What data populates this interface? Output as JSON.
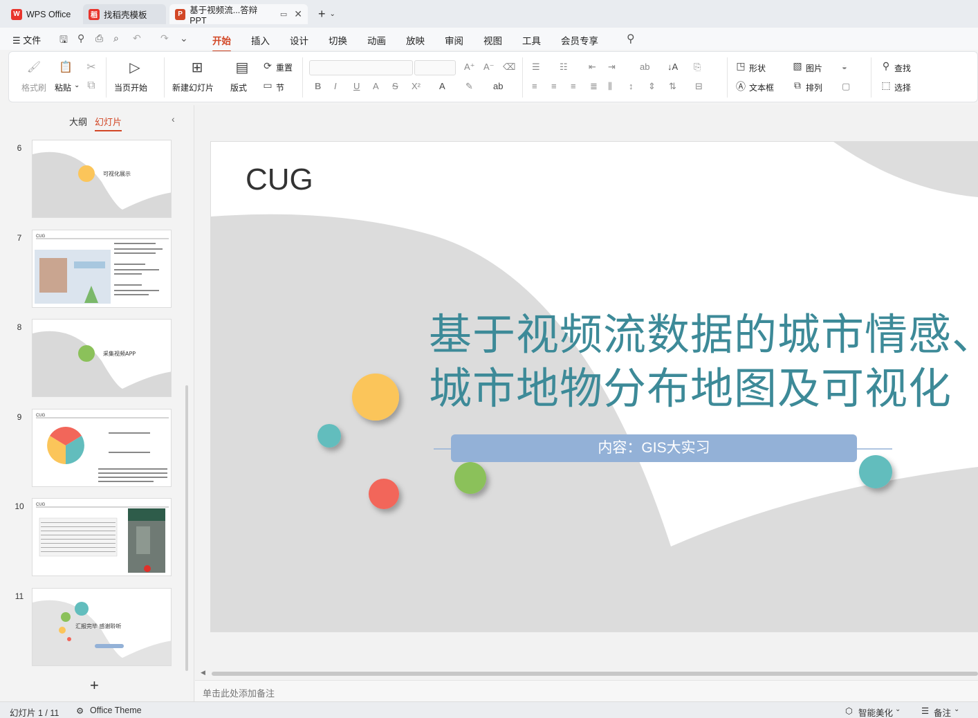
{
  "tabs": {
    "wps": "WPS Office",
    "daoke": "找稻壳模板",
    "doc": "基于视频流...答辩PPT"
  },
  "menu": {
    "file": "文件",
    "tabs": [
      "开始",
      "插入",
      "设计",
      "切换",
      "动画",
      "放映",
      "审阅",
      "视图",
      "工具",
      "会员专享"
    ],
    "active": "开始"
  },
  "ribbon": {
    "format_painter": "格式刷",
    "paste": "粘贴",
    "play_from_current": "当页开始",
    "new_slide": "新建幻灯片",
    "layout": "版式",
    "reset": "重置",
    "section": "节",
    "shape": "形状",
    "picture": "图片",
    "find": "查找",
    "textbox": "文本框",
    "arrange": "排列",
    "select": "选择"
  },
  "left_panel": {
    "outline_tab": "大纲",
    "slides_tab": "幻灯片",
    "slide_numbers": [
      "6",
      "7",
      "8",
      "9",
      "10",
      "11"
    ],
    "thumb6_text": "可视化展示",
    "thumb8_text": "采集视频APP",
    "thumb11_text": "汇报完毕 感谢聆听"
  },
  "slide": {
    "logo_text": "CUG",
    "title_line1": "基于视频流数据的城市情感、",
    "title_line2": "城市地物分布地图及可视化",
    "subtitle": "内容：GIS大实习"
  },
  "notes_placeholder": "单击此处添加备注",
  "status": {
    "slide_counter": "幻灯片 1 / 11",
    "theme": "Office Theme",
    "beautify": "智能美化",
    "notes": "备注"
  },
  "colors": {
    "accent": "#d24726",
    "title": "#3d8a98",
    "subtitle_bar": "#93b1d7",
    "dot_yellow": "#fbc55a",
    "dot_teal": "#62bdbd",
    "dot_red": "#f2665a",
    "dot_green": "#8bc15a"
  }
}
